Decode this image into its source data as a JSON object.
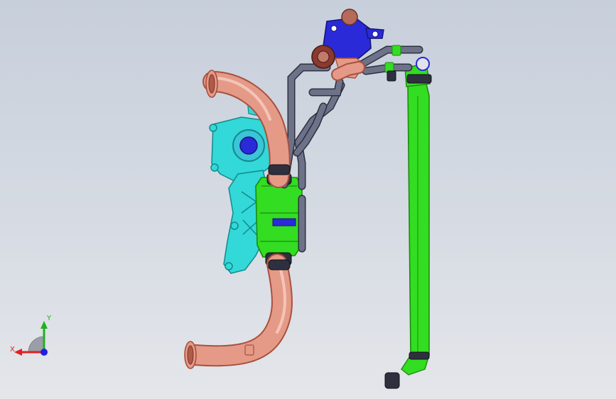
{
  "view": {
    "background_top": "#c7cfdb",
    "background_bottom": "#e4e6ea"
  },
  "model": {
    "colors": {
      "duct": "#e59a88",
      "duct_dark": "#a9503f",
      "intercooler": "#33dd22",
      "intercooler_dark": "#1c8a10",
      "bracket": "#33d8d8",
      "bracket_dark": "#138a8a",
      "hose": "#6e7288",
      "hose_dark": "#2e3040",
      "valve": "#2a2ad8",
      "valve_dark": "#15157a",
      "clamp": "#8a3a30"
    }
  },
  "triad": {
    "x_label": "X",
    "y_label": "Y",
    "x_color": "#e02020",
    "y_color": "#20b020",
    "z_color": "#2020e0",
    "icon": "coordinate-triad-icon"
  }
}
